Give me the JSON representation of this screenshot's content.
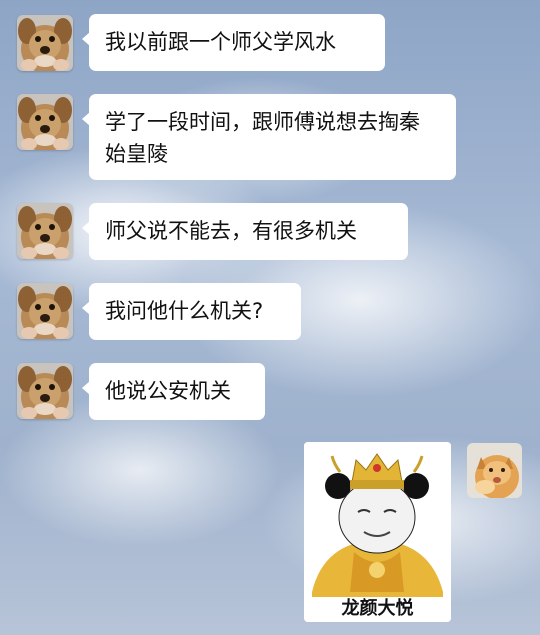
{
  "messages": [
    {
      "sender": "left",
      "avatar_icon": "dog-avatar-icon",
      "text": "我以前跟一个师父学风水"
    },
    {
      "sender": "left",
      "avatar_icon": "dog-avatar-icon",
      "text": "学了一段时间，跟师傅说想去掏秦始皇陵"
    },
    {
      "sender": "left",
      "avatar_icon": "dog-avatar-icon",
      "text": "师父说不能去，有很多机关"
    },
    {
      "sender": "left",
      "avatar_icon": "dog-avatar-icon",
      "text": "我问他什么机关?"
    },
    {
      "sender": "left",
      "avatar_icon": "dog-avatar-icon",
      "text": "他说公安机关"
    }
  ],
  "reply": {
    "sender": "right",
    "avatar_icon": "cat-avatar-icon",
    "sticker_icon": "panda-emperor-sticker-icon",
    "sticker_caption": "龙颜大悦"
  }
}
